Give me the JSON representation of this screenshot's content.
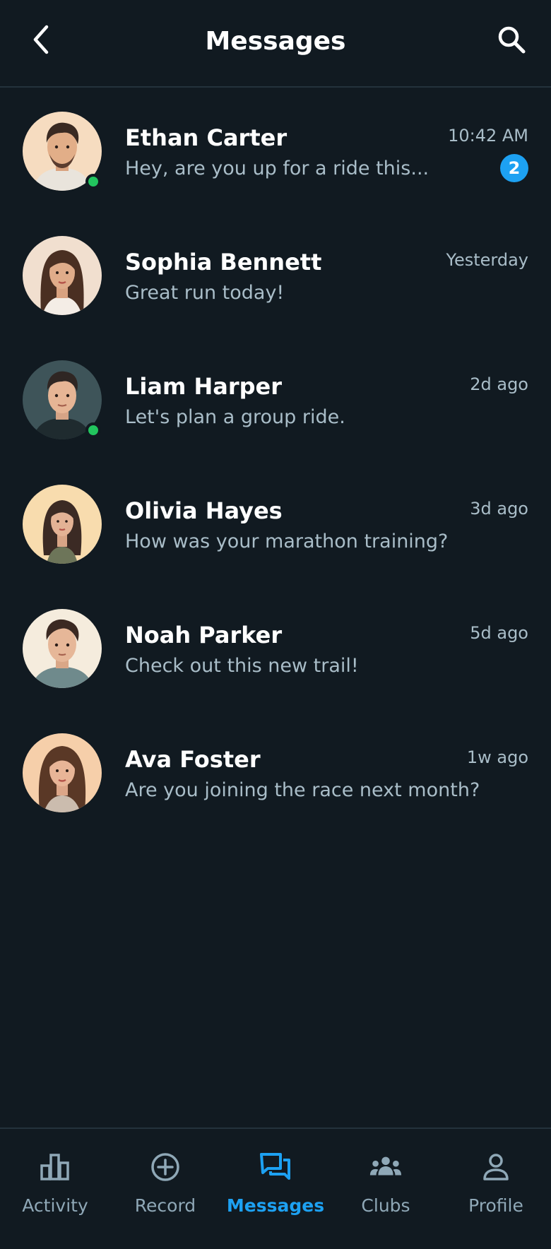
{
  "header": {
    "title": "Messages",
    "back_icon": "chevron-left-icon",
    "search_icon": "search-icon"
  },
  "conversations": [
    {
      "name": "Ethan Carter",
      "preview": "Hey, are you up for a ride this...",
      "time": "10:42 AM",
      "unread": "2",
      "online": true
    },
    {
      "name": "Sophia Bennett",
      "preview": "Great run today!",
      "time": "Yesterday",
      "unread": null,
      "online": false
    },
    {
      "name": "Liam Harper",
      "preview": "Let's plan a group ride.",
      "time": "2d ago",
      "unread": null,
      "online": true
    },
    {
      "name": "Olivia Hayes",
      "preview": "How was your marathon training?",
      "time": "3d ago",
      "unread": null,
      "online": false
    },
    {
      "name": "Noah Parker",
      "preview": "Check out this new trail!",
      "time": "5d ago",
      "unread": null,
      "online": false
    },
    {
      "name": "Ava Foster",
      "preview": "Are you joining the race next month?",
      "time": "1w ago",
      "unread": null,
      "online": false
    }
  ],
  "bottom_nav": [
    {
      "label": "Activity",
      "icon": "bar-chart-icon",
      "active": false
    },
    {
      "label": "Record",
      "icon": "plus-circle-icon",
      "active": false
    },
    {
      "label": "Messages",
      "icon": "chat-bubbles-icon",
      "active": true
    },
    {
      "label": "Clubs",
      "icon": "group-icon",
      "active": false
    },
    {
      "label": "Profile",
      "icon": "person-icon",
      "active": false
    }
  ],
  "colors": {
    "background": "#111a21",
    "accent": "#1da1f2",
    "online": "#22c55e",
    "muted_text": "#a9bdc8"
  }
}
